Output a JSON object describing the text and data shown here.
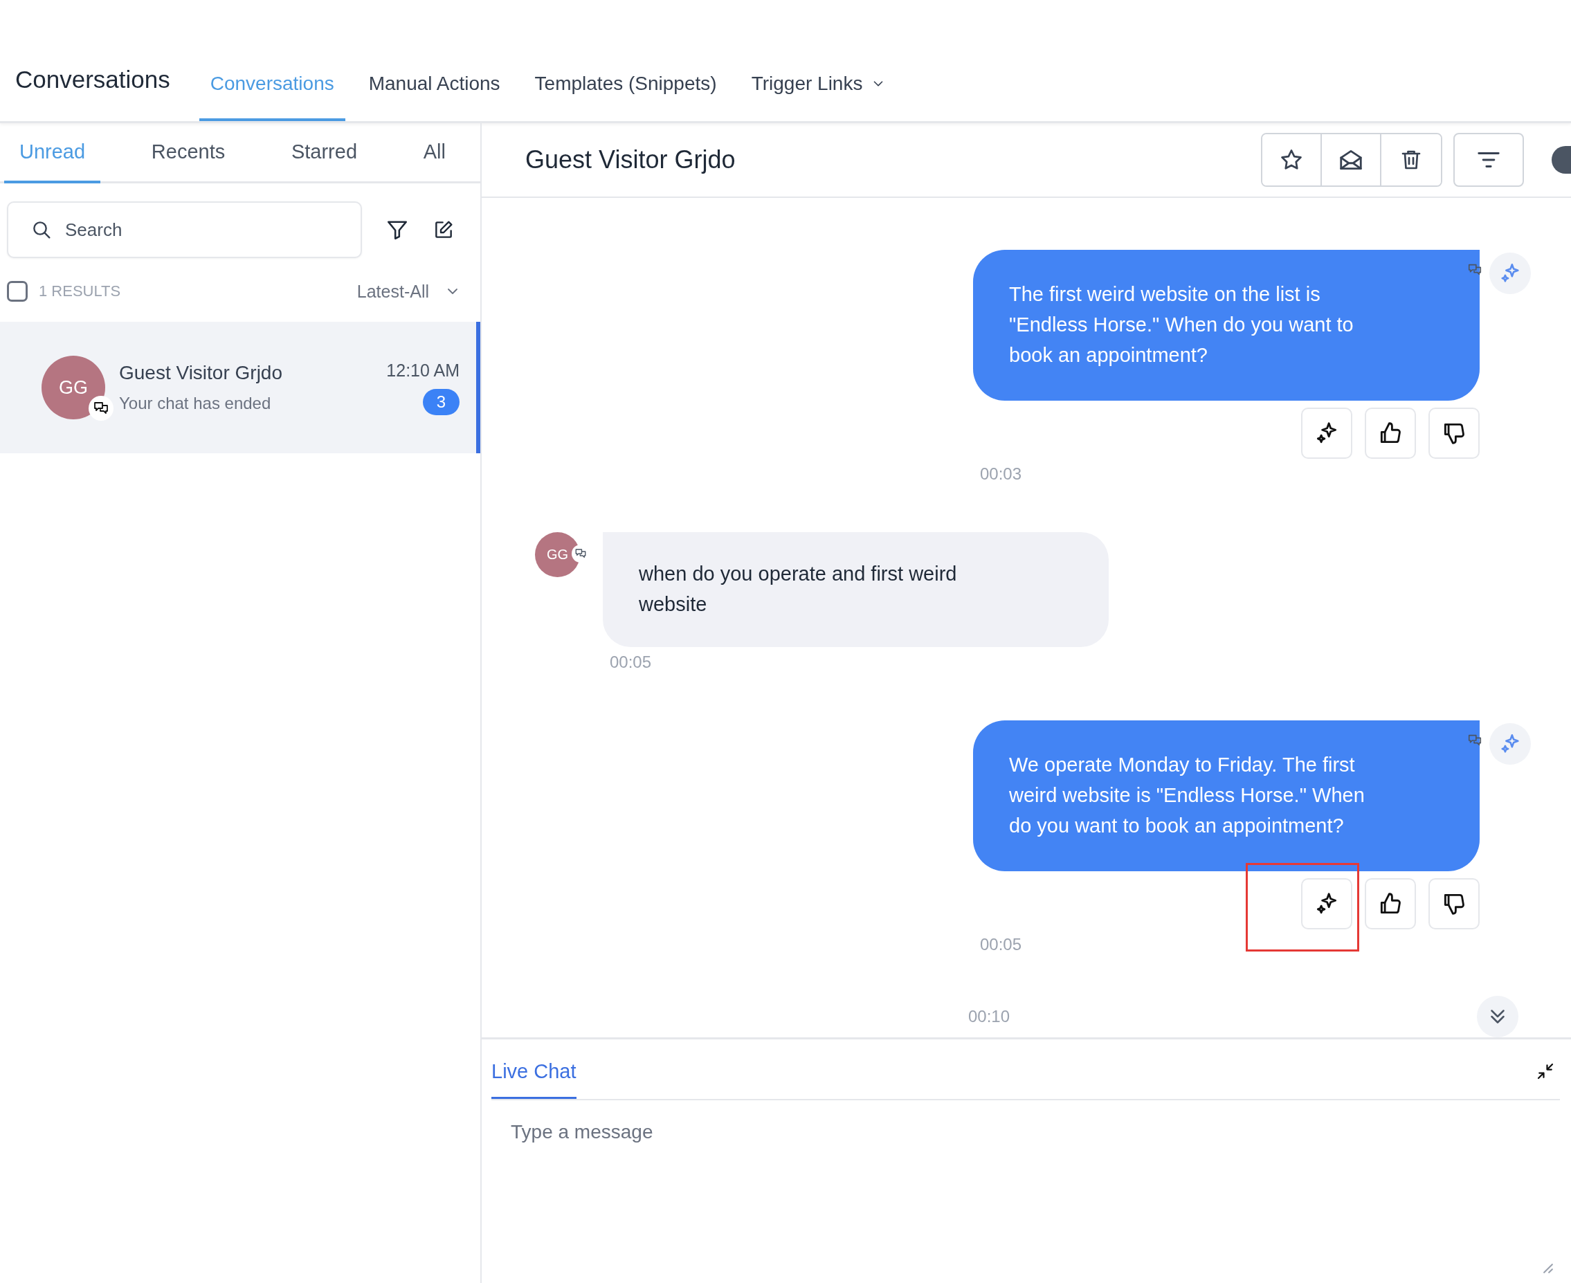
{
  "header": {
    "title": "Conversations",
    "tabs": [
      {
        "label": "Conversations",
        "selected": true,
        "kind": "link"
      },
      {
        "label": "Manual Actions",
        "selected": false,
        "kind": "link"
      },
      {
        "label": "Templates (Snippets)",
        "selected": false,
        "kind": "link"
      },
      {
        "label": "Trigger Links",
        "selected": false,
        "kind": "dropdown"
      }
    ]
  },
  "list_tabs": [
    {
      "label": "Unread",
      "selected": true
    },
    {
      "label": "Recents",
      "selected": false
    },
    {
      "label": "Starred",
      "selected": false
    },
    {
      "label": "All",
      "selected": false
    }
  ],
  "search": {
    "placeholder": "Search"
  },
  "results": {
    "checked": false,
    "count": "1 RESULTS",
    "sort": "Latest-All"
  },
  "conversations": [
    {
      "initials": "GG",
      "name": "Guest Visitor Grjdo",
      "preview": "Your chat has ended",
      "time": "12:10 AM",
      "unread": "3",
      "selected": true
    }
  ],
  "chat": {
    "title": "Guest Visitor Grjdo",
    "messages": [
      {
        "kind": "outgoing",
        "text": "The first weird website on the list is \"Endless Horse.\" When do you want to book an appointment?",
        "time": "00:03",
        "highlighted": false
      },
      {
        "kind": "incoming",
        "initials": "GG",
        "text": "when do you operate and first weird website",
        "time": "00:05"
      },
      {
        "kind": "outgoing",
        "text": "We operate Monday to Friday. The first weird website is \"Endless Horse.\" When do you want to book an appointment?",
        "time": "00:05",
        "highlighted": true
      }
    ],
    "last_time": "00:10"
  },
  "composer": {
    "tabs": [
      {
        "label": "Live Chat",
        "selected": true
      }
    ],
    "placeholder": "Type a message"
  }
}
